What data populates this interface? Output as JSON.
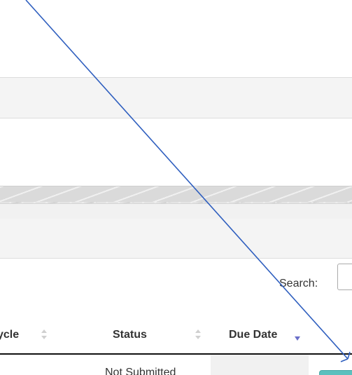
{
  "search": {
    "label": "Search:",
    "value": "",
    "placeholder": ""
  },
  "table": {
    "columns": [
      {
        "label": "ycle",
        "sort": "unsorted"
      },
      {
        "label": "Status",
        "sort": "unsorted"
      },
      {
        "label": "Due Date",
        "sort": "ascending"
      }
    ],
    "rows": [
      {
        "status": "Not Submitted"
      }
    ]
  },
  "colors": {
    "sort_active": "#6a6fc9",
    "sort_inactive": "#d0d0d0",
    "pointer_line": "#2f5fbf",
    "row_button": "#5bc0be"
  },
  "icons": {
    "sort_unsorted": "sort-both-icon",
    "sort_ascending": "sort-down-icon",
    "pointer": "arrow-pointer-icon"
  }
}
